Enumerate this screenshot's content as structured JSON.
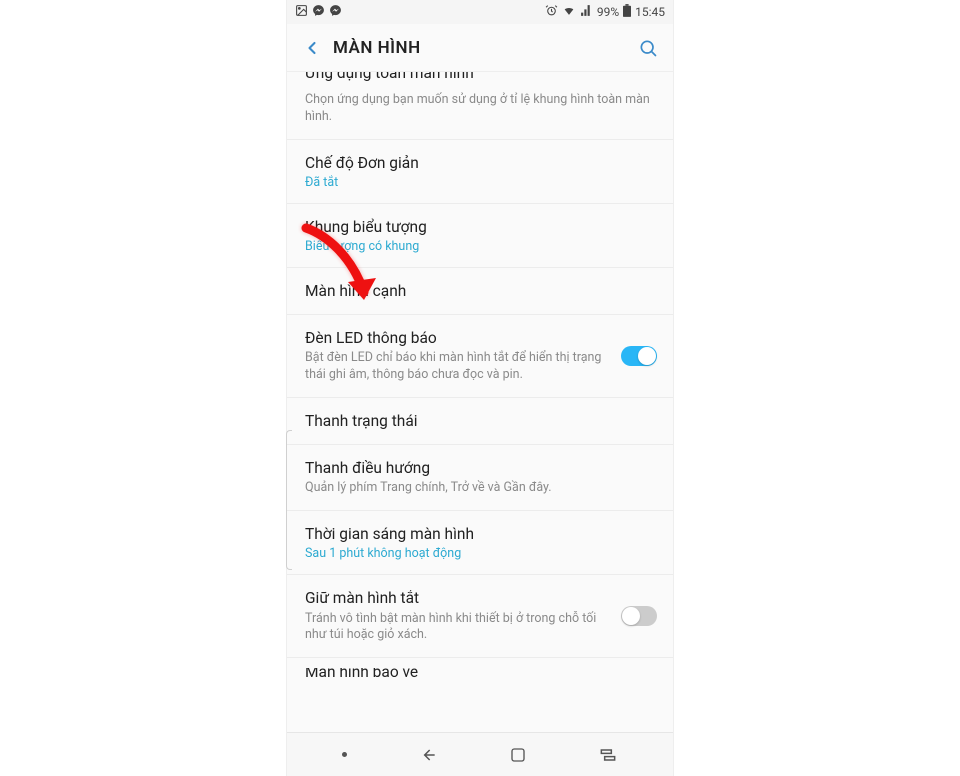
{
  "status": {
    "battery": "99%",
    "time": "15:45"
  },
  "header": {
    "title": "MÀN HÌNH"
  },
  "items": {
    "fullscreen": {
      "title_cut": "Ứng dụng toàn màn hình",
      "desc": "Chọn ứng dụng bạn muốn sử dụng ở tỉ lệ khung hình toàn màn hình."
    },
    "simple": {
      "title": "Chế độ Đơn giản",
      "value": "Đã tắt"
    },
    "iconframe": {
      "title": "Khung biểu tượng",
      "value": "Biểu tượng có khung"
    },
    "edge": {
      "title": "Màn hình cạnh"
    },
    "led": {
      "title": "Đèn LED thông báo",
      "desc": "Bật đèn LED chỉ báo khi màn hình tắt để hiển thị trạng thái ghi âm, thông báo chưa đọc và pin."
    },
    "statusbar": {
      "title": "Thanh trạng thái"
    },
    "navbar": {
      "title": "Thanh điều hướng",
      "desc": "Quản lý phím Trang chính, Trở về và Gần đây."
    },
    "timeout": {
      "title": "Thời gian sáng màn hình",
      "value": "Sau 1 phút không hoạt động"
    },
    "keepoff": {
      "title": "Giữ màn hình tắt",
      "desc": "Tránh vô tình bật màn hình khi thiết bị ở trong chỗ tối như túi hoặc giỏ xách."
    },
    "last": {
      "title_cut": "Màn hình bảo vệ"
    }
  }
}
